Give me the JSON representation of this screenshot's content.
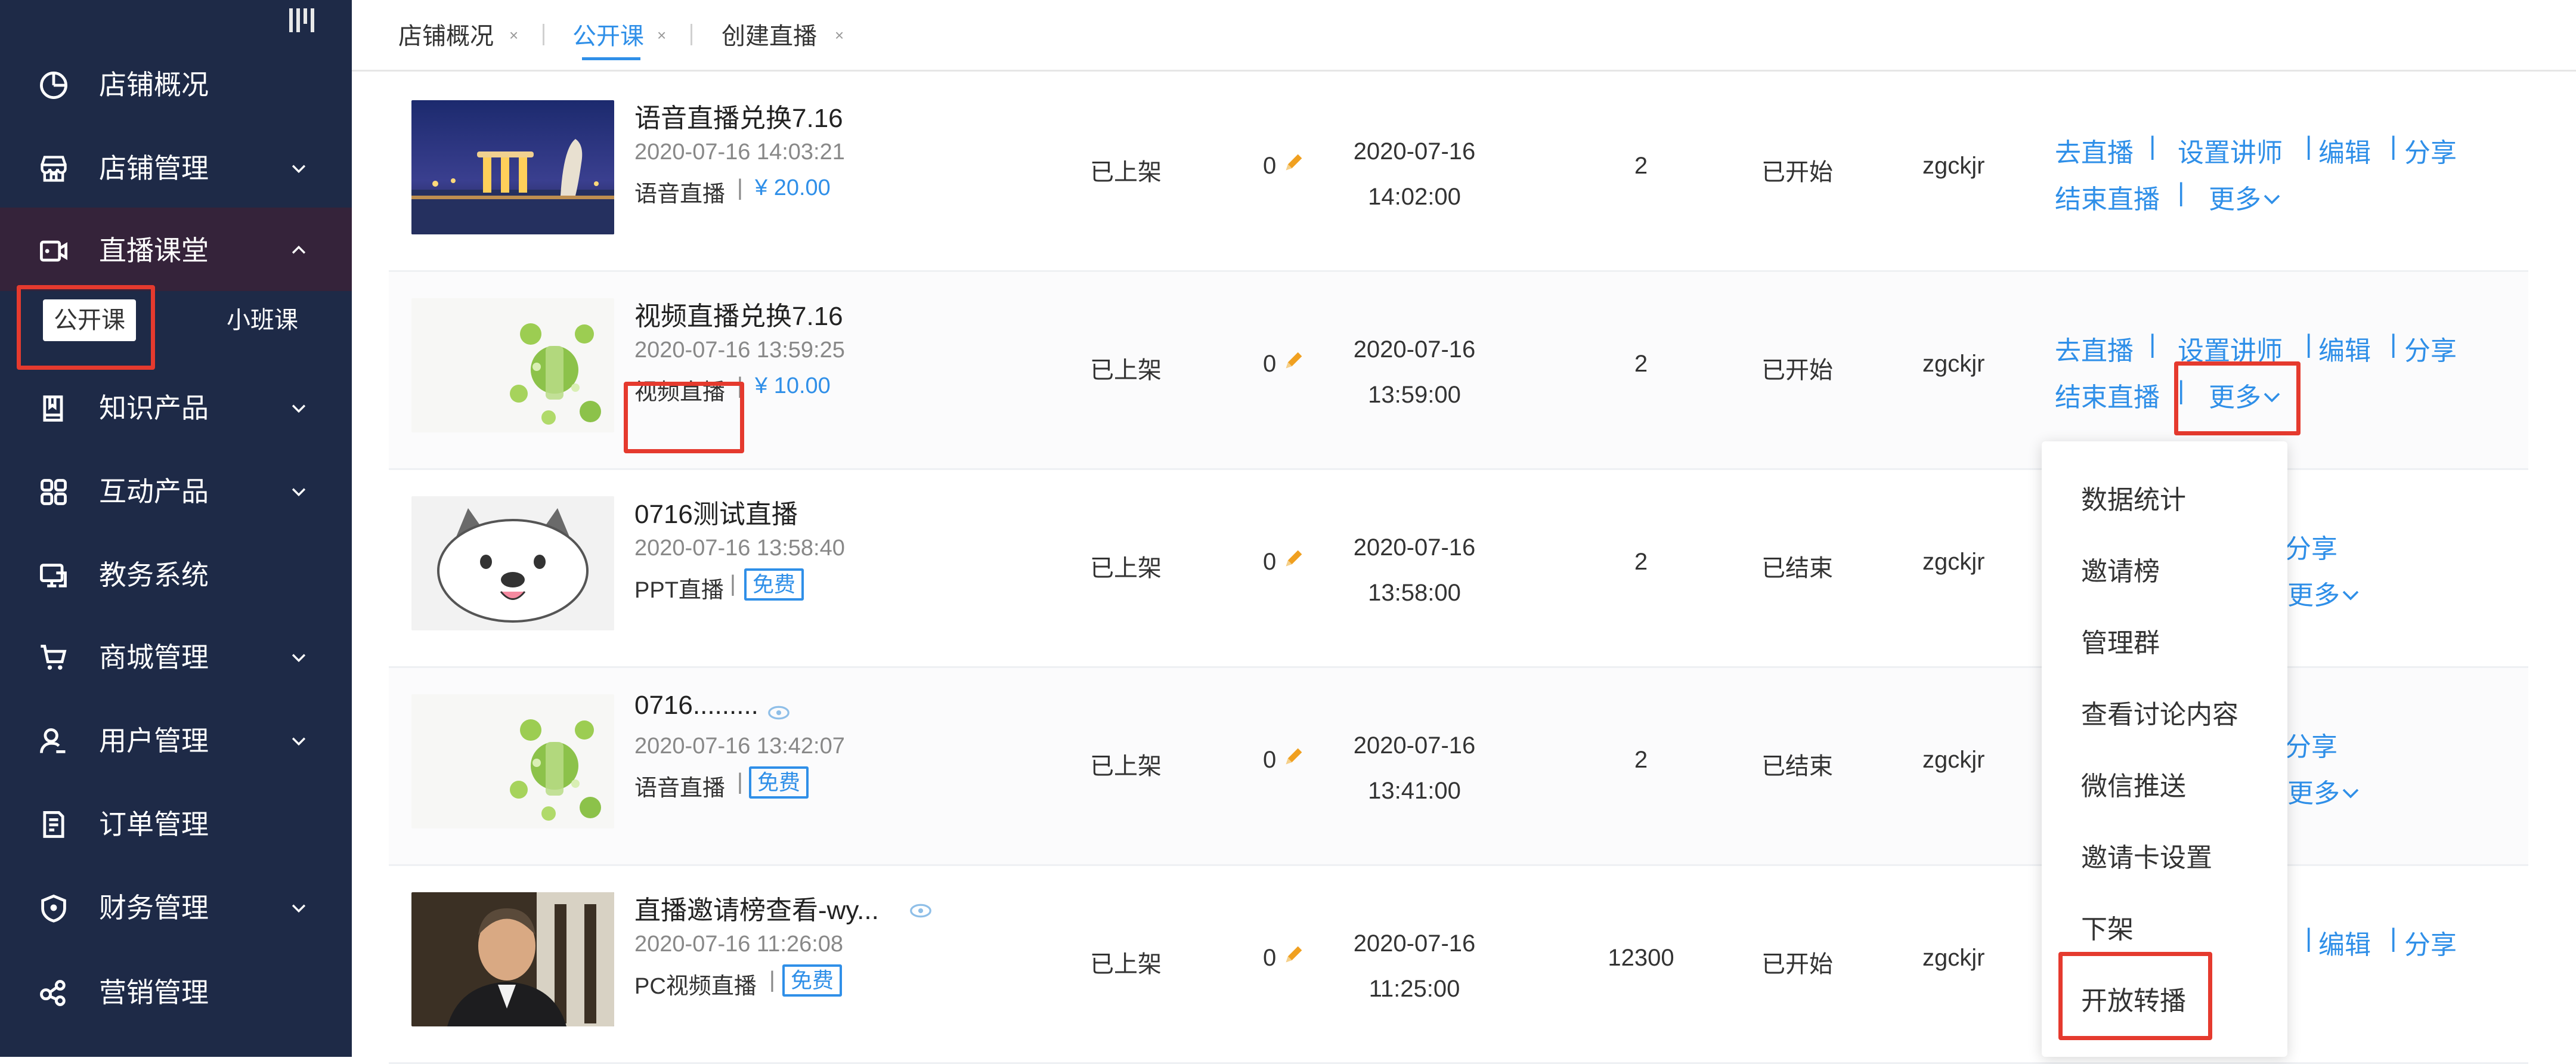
{
  "sidebar": {
    "items": [
      {
        "label": "店铺概况",
        "icon": "pie-chart-icon"
      },
      {
        "label": "店铺管理",
        "icon": "store-icon"
      },
      {
        "label": "直播课堂",
        "icon": "video-icon"
      },
      {
        "label": "知识产品",
        "icon": "book-icon"
      },
      {
        "label": "互动产品",
        "icon": "grid-icon"
      },
      {
        "label": "教务系统",
        "icon": "monitor-icon"
      },
      {
        "label": "商城管理",
        "icon": "cart-icon"
      },
      {
        "label": "用户管理",
        "icon": "user-icon"
      },
      {
        "label": "订单管理",
        "icon": "order-icon"
      },
      {
        "label": "财务管理",
        "icon": "shield-icon"
      },
      {
        "label": "营销管理",
        "icon": "share-icon"
      }
    ],
    "sub_items": {
      "public": "公开课",
      "small": "小班课"
    }
  },
  "tabs": [
    {
      "label": "店铺概况",
      "close": "×"
    },
    {
      "label": "公开课",
      "close": "×"
    },
    {
      "label": "创建直播",
      "close": "×"
    }
  ],
  "rows": [
    {
      "title": "语音直播兑换7.16",
      "time": "2020-07-16 14:03:21",
      "type": "语音直播",
      "price": "¥ 20.00",
      "status": "已上架",
      "sort": "0",
      "date": "2020-07-16",
      "clock": "14:02:00",
      "count": "2",
      "state": "已开始",
      "user": "zgckjr"
    },
    {
      "title": "视频直播兑换7.16",
      "time": "2020-07-16 13:59:25",
      "type": "视频直播",
      "price": "¥ 10.00",
      "status": "已上架",
      "sort": "0",
      "date": "2020-07-16",
      "clock": "13:59:00",
      "count": "2",
      "state": "已开始",
      "user": "zgckjr"
    },
    {
      "title": "0716测试直播",
      "time": "2020-07-16 13:58:40",
      "type": "PPT直播",
      "free": "免费",
      "status": "已上架",
      "sort": "0",
      "date": "2020-07-16",
      "clock": "13:58:00",
      "count": "2",
      "state": "已结束",
      "user": "zgckjr"
    },
    {
      "title": "0716.........",
      "time": "2020-07-16 13:42:07",
      "type": "语音直播",
      "free": "免费",
      "status": "已上架",
      "sort": "0",
      "date": "2020-07-16",
      "clock": "13:41:00",
      "count": "2",
      "state": "已结束",
      "user": "zgckjr"
    },
    {
      "title": "直播邀请榜查看-wy...",
      "time": "2020-07-16 11:26:08",
      "type": "PC视频直播",
      "free": "免费",
      "status": "已上架",
      "sort": "0",
      "date": "2020-07-16",
      "clock": "11:25:00",
      "count": "12300",
      "state": "已开始",
      "user": "zgckjr"
    }
  ],
  "actions": {
    "go_live": "去直播",
    "set_lecturer": "设置讲师",
    "edit": "编辑",
    "share": "分享",
    "end_live": "结束直播",
    "more": "更多",
    "sep": "|"
  },
  "dropdown": [
    "数据统计",
    "邀请榜",
    "管理群",
    "查看讨论内容",
    "微信推送",
    "邀请卡设置",
    "下架",
    "开放转播"
  ],
  "colors": {
    "sidebar_bg": "#1e2a47",
    "accent": "#2f8fe8",
    "highlight": "#e53a2e"
  }
}
